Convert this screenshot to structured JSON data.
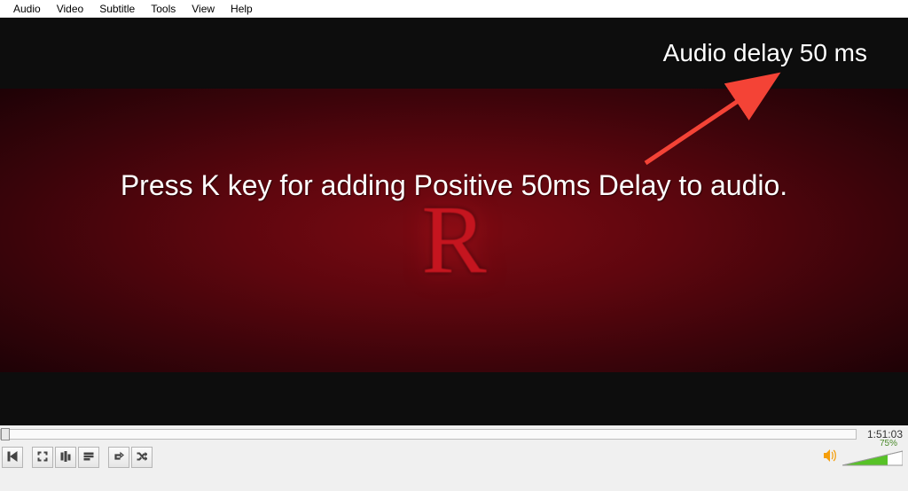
{
  "menu": {
    "items": [
      "Audio",
      "Video",
      "Subtitle",
      "Tools",
      "View",
      "Help"
    ]
  },
  "osd": {
    "audio_delay": "Audio delay 50 ms"
  },
  "annotation": {
    "instruction": "Press K key for adding Positive 50ms Delay to audio."
  },
  "video": {
    "logo_letter": "R"
  },
  "seek": {
    "duration": "1:51:03"
  },
  "volume": {
    "percent": "75%"
  }
}
